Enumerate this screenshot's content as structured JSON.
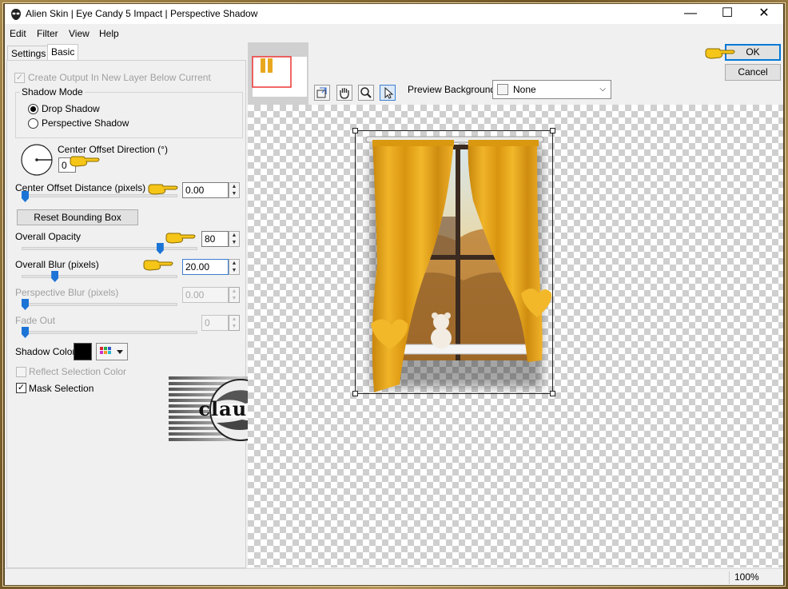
{
  "window": {
    "title": "Alien Skin | Eye Candy 5 Impact | Perspective Shadow",
    "minimize": "—",
    "maximize": "☐",
    "close": "✕",
    "icon": "alien-skin-icon"
  },
  "menu": [
    "Edit",
    "Filter",
    "View",
    "Help"
  ],
  "tabs": {
    "settings": "Settings",
    "basic": "Basic"
  },
  "basic": {
    "create_output_label": "Create Output In New Layer Below Current",
    "create_output_checked": true,
    "shadow_mode_title": "Shadow Mode",
    "shadow_mode_options": [
      "Drop Shadow",
      "Perspective Shadow"
    ],
    "shadow_mode_selected": "Drop Shadow",
    "center_offset_direction_label": "Center Offset Direction (°)",
    "center_offset_direction_value": "0",
    "center_offset_distance_label": "Center Offset Distance (pixels)",
    "center_offset_distance_value": "0.00",
    "reset_bounding_box_label": "Reset Bounding Box",
    "overall_opacity_label": "Overall Opacity",
    "overall_opacity_value": "80",
    "overall_blur_label": "Overall Blur (pixels)",
    "overall_blur_value": "20.00",
    "perspective_blur_label": "Perspective Blur (pixels)",
    "perspective_blur_value": "0.00",
    "fade_out_label": "Fade Out",
    "fade_out_value": "0",
    "shadow_color_label": "Shadow Color",
    "shadow_color": "#000000",
    "reflect_selection_color_label": "Reflect Selection Color",
    "reflect_selection_color_checked": false,
    "mask_selection_label": "Mask Selection",
    "mask_selection_checked": true
  },
  "sliders": {
    "center_offset_distance": 0.0,
    "overall_opacity": 0.8,
    "overall_blur": 0.2,
    "perspective_blur": 0.0,
    "fade_out": 0.0
  },
  "watermark": {
    "text": "claudia"
  },
  "buttons": {
    "ok": "OK",
    "cancel": "Cancel"
  },
  "preview": {
    "background_label": "Preview Background:",
    "background_value": "None",
    "tools": [
      "transform-icon",
      "hand-icon",
      "zoom-icon",
      "arrow-icon"
    ]
  },
  "status": {
    "zoom": "100%"
  },
  "colors": {
    "curtain": "#e8a81e",
    "accent": "#0078d7",
    "pointer_hand": "#f5c518"
  }
}
